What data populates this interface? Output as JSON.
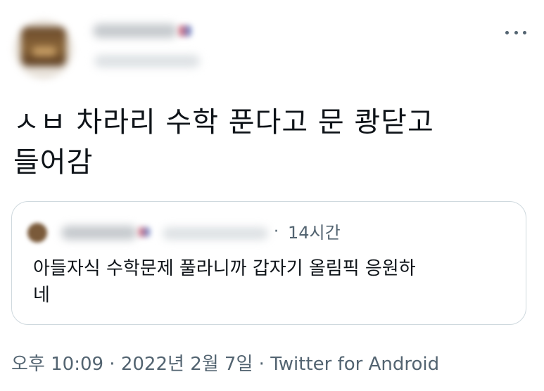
{
  "author": {
    "avatar": "avatar-image-blurred",
    "display_name_state": "blurred",
    "handle_state": "blurred"
  },
  "menu": {
    "icon": "more-horizontal-icon"
  },
  "tweet": {
    "text": "ㅅㅂ 차라리 수학 푼다고 문 쾅닫고\n들어감"
  },
  "quote": {
    "separator": "·",
    "time": "14시간",
    "text": "아들자식 수학문제 풀라니까 갑자기 올림픽 응원하\n네"
  },
  "meta": {
    "time": "오후 10:09",
    "separator": " · ",
    "date": "2022년 2월 7일",
    "source": "Twitter for Android"
  },
  "colors": {
    "text_primary": "#0f1419",
    "text_secondary": "#536471",
    "border": "#cfd9de"
  }
}
